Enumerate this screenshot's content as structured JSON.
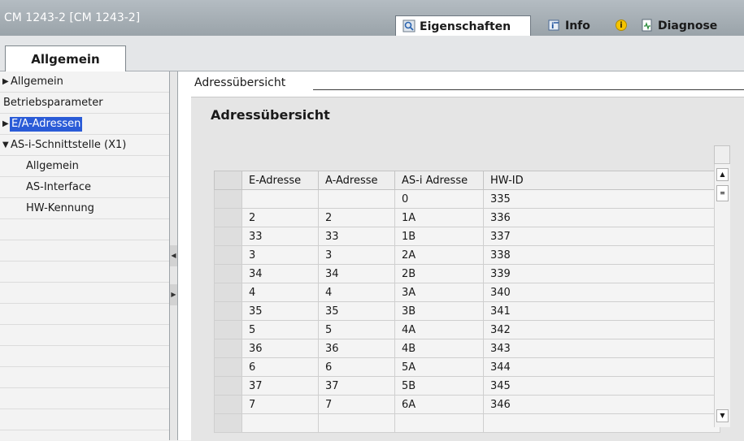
{
  "window": {
    "title": "CM 1243-2 [CM 1243-2]",
    "tabs": {
      "properties": "Eigenschaften",
      "info": "Info",
      "diagnostics": "Diagnose"
    }
  },
  "general_tab": "Allgemein",
  "nav": {
    "items": [
      {
        "label": "Allgemein",
        "arrow": "▶"
      },
      {
        "label": "Betriebsparameter",
        "arrow": ""
      },
      {
        "label": "E/A-Adressen",
        "arrow": "▶"
      },
      {
        "label": "AS-i-Schnittstelle (X1)",
        "arrow": "▼"
      },
      {
        "label": "Allgemein",
        "arrow": ""
      },
      {
        "label": "AS-Interface",
        "arrow": ""
      },
      {
        "label": "HW-Kennung",
        "arrow": ""
      }
    ]
  },
  "section": {
    "heading": "Adressübersicht",
    "panel_title": "Adressübersicht"
  },
  "table": {
    "columns": [
      "E-Adresse",
      "A-Adresse",
      "AS-i Adresse",
      "HW-ID"
    ],
    "rows": [
      [
        "",
        "",
        "0",
        "335"
      ],
      [
        "2",
        "2",
        "1A",
        "336"
      ],
      [
        "33",
        "33",
        "1B",
        "337"
      ],
      [
        "3",
        "3",
        "2A",
        "338"
      ],
      [
        "34",
        "34",
        "2B",
        "339"
      ],
      [
        "4",
        "4",
        "3A",
        "340"
      ],
      [
        "35",
        "35",
        "3B",
        "341"
      ],
      [
        "5",
        "5",
        "4A",
        "342"
      ],
      [
        "36",
        "36",
        "4B",
        "343"
      ],
      [
        "6",
        "6",
        "5A",
        "344"
      ],
      [
        "37",
        "37",
        "5B",
        "345"
      ],
      [
        "7",
        "7",
        "6A",
        "346"
      ]
    ]
  },
  "colors": {
    "selection": "#2a5bd7",
    "title_bar": "#a8b0b6",
    "info_icon": "#f5c400"
  }
}
